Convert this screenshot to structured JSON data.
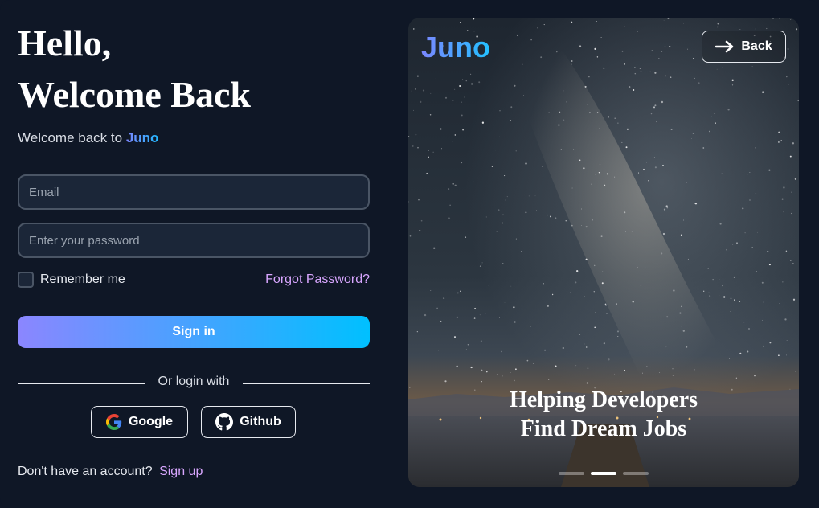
{
  "left": {
    "title_line1": "Hello,",
    "title_line2": "Welcome Back",
    "subtitle_prefix": "Welcome back to",
    "subtitle_brand": "Juno",
    "email_placeholder": "Email",
    "password_placeholder": "Enter your password",
    "remember_label": "Remember me",
    "forgot_label": "Forgot Password?",
    "signin_label": "Sign in",
    "divider_label": "Or login with",
    "google_label": "Google",
    "github_label": "Github",
    "signup_prompt": "Don't have an account?",
    "signup_label": "Sign up"
  },
  "right": {
    "logo": "Juno",
    "back_label": "Back",
    "tagline_line1": "Helping Developers",
    "tagline_line2": "Find Dream Jobs",
    "carousel_active_index": 1,
    "carousel_count": 3
  },
  "colors": {
    "background": "#0f1726",
    "accent_start": "#8b86ff",
    "accent_end": "#00c0ff",
    "link": "#d8a6ff"
  }
}
